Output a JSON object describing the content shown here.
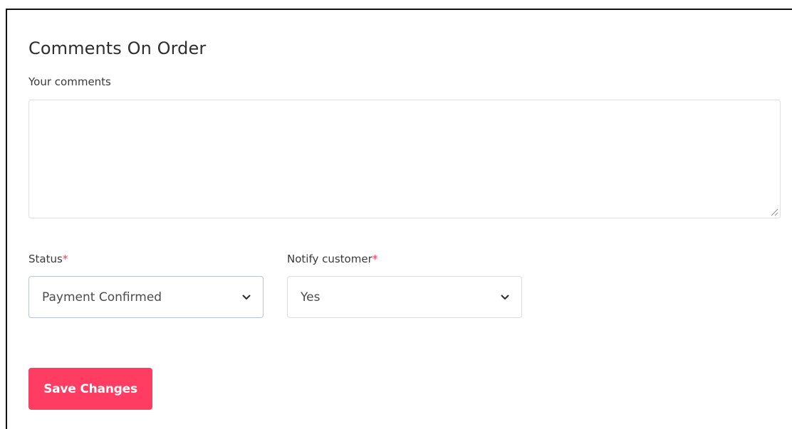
{
  "form": {
    "title": "Comments On Order",
    "comments": {
      "label": "Your comments",
      "value": ""
    },
    "status": {
      "label": "Status",
      "required_mark": "*",
      "selected": "Payment Confirmed"
    },
    "notify_customer": {
      "label": "Notify customer",
      "required_mark": "*",
      "selected": "Yes"
    },
    "save_label": "Save Changes"
  },
  "colors": {
    "accent": "#ff3d62",
    "required": "#ef3e5a",
    "border": "#dcdfe3"
  },
  "icons": {
    "dropdown": "chevron-down-icon",
    "resize": "resize-grip-icon"
  }
}
